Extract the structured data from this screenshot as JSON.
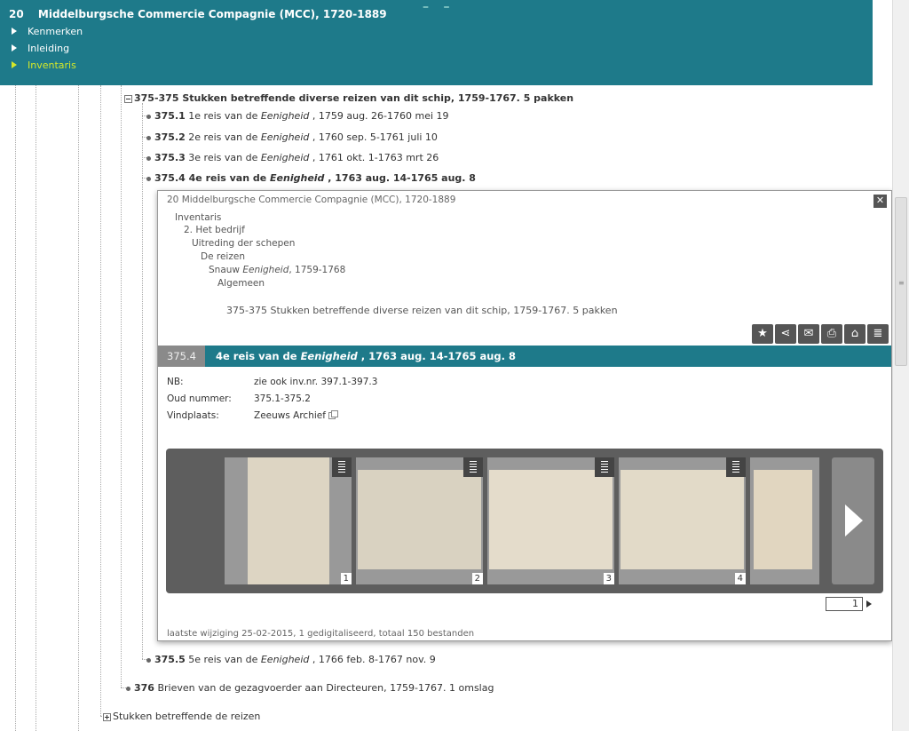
{
  "header": {
    "archive_num": "20",
    "archive_title": "Middelburgsche Commercie Compagnie (MCC), 1720-1889",
    "dashes": "– –",
    "nav": [
      {
        "label": "Kenmerken",
        "active": false
      },
      {
        "label": "Inleiding",
        "active": false
      },
      {
        "label": "Inventaris",
        "active": true
      }
    ]
  },
  "tree": {
    "group_title": "375-375 Stukken betreffende diverse reizen van dit schip, 1759-1767. 5 pakken",
    "items": [
      {
        "num": "375.1",
        "pre": "1e reis van de ",
        "ship": "Eenigheid",
        "post": " , 1759 aug. 26-1760 mei 19"
      },
      {
        "num": "375.2",
        "pre": "2e reis van de ",
        "ship": "Eenigheid",
        "post": " , 1760 sep. 5-1761 juli 10"
      },
      {
        "num": "375.3",
        "pre": "3e reis van de ",
        "ship": "Eenigheid",
        "post": " , 1761 okt. 1-1763 mrt 26"
      },
      {
        "num": "375.4",
        "pre": "4e reis van de ",
        "ship": "Eenigheid",
        "post": " , 1763 aug. 14-1765 aug. 8"
      },
      {
        "num": "375.5",
        "pre": "5e reis van de ",
        "ship": "Eenigheid",
        "post": " , 1766 feb. 8-1767 nov. 9"
      }
    ],
    "item_376_num": "376",
    "item_376_text": "Brieven van de gezagvoerder aan Directeuren, 1759-1767. 1 omslag",
    "collapsed_group": "Stukken betreffende de reizen"
  },
  "popup": {
    "close": "✕",
    "archive": "20 Middelburgsche Commercie Compagnie (MCC), 1720-1889",
    "crumbs": [
      "Inventaris",
      "2. Het bedrijf",
      "Uitreding der schepen",
      "De reizen"
    ],
    "crumb_ship_pre": "Snauw ",
    "crumb_ship": "Eenigheid",
    "crumb_ship_post": ", 1759-1768",
    "crumb_last": "Algemeen",
    "group_title": "375-375 Stukken betreffende diverse reizen van dit schip, 1759-1767. 5 pakken",
    "tools": [
      "pin-icon",
      "share-icon",
      "mail-icon",
      "print-icon",
      "museum-icon",
      "document-icon"
    ],
    "bar_index": "375.4",
    "bar_pre": "4e reis van de ",
    "bar_ship": "Eenigheid",
    "bar_post": " , 1763 aug. 14-1765 aug. 8",
    "fields": [
      {
        "label": "NB:",
        "value": "zie ook inv.nr. 397.1-397.3"
      },
      {
        "label": "Oud nummer:",
        "value": "375.1-375.2"
      },
      {
        "label": "Vindplaats:",
        "value": "Zeeuws Archief"
      }
    ],
    "thumbs": [
      "1",
      "2",
      "3",
      "4"
    ],
    "pager_value": "1",
    "footer": "laatste wijziging 25-02-2015,  1 gedigitaliseerd, totaal 150 bestanden"
  },
  "colors": {
    "accent": "#1e7a8a",
    "active_nav": "#d4e829"
  }
}
